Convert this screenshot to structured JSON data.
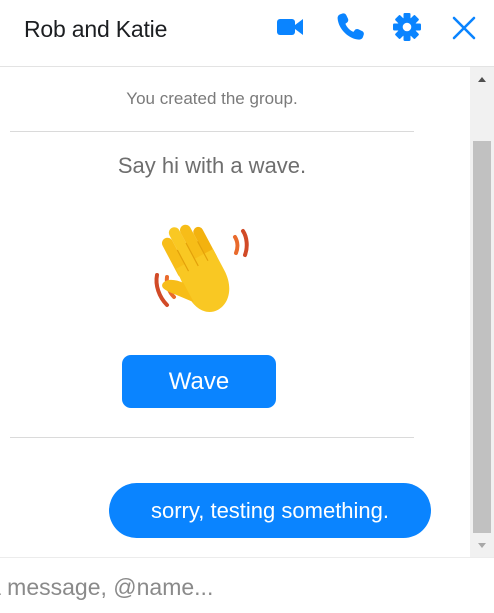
{
  "header": {
    "title": "Rob and Katie",
    "icons": [
      "video-camera-icon",
      "phone-icon",
      "gear-icon",
      "close-icon"
    ],
    "accent_color": "#0a84ff"
  },
  "chat": {
    "system_message": "You created the group.",
    "wave_prompt": "Say hi with a wave.",
    "wave_emoji": "waving-hand-icon",
    "wave_button_label": "Wave",
    "messages": [
      {
        "text": "sorry, testing something.",
        "outgoing": true
      }
    ]
  },
  "composer": {
    "placeholder": "a message, @name..."
  }
}
